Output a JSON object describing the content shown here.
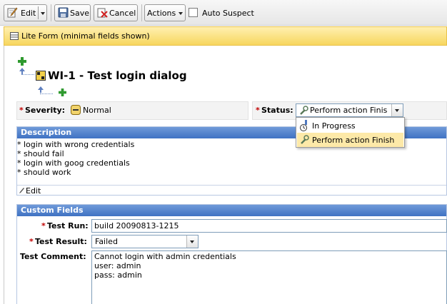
{
  "toolbar": {
    "edit_label": "Edit",
    "save_label": "Save",
    "cancel_label": "Cancel",
    "actions_label": "Actions",
    "auto_suspect_label": "Auto Suspect"
  },
  "banner": {
    "text": "Lite Form (minimal fields shown)"
  },
  "work_item": {
    "title": "WI-1 - Test login dialog"
  },
  "severity": {
    "label": "Severity:",
    "value": "Normal"
  },
  "status": {
    "label": "Status:",
    "value": "Perform action Finis",
    "options": [
      "In Progress",
      "Perform action Finish"
    ]
  },
  "description": {
    "header": "Description",
    "lines": [
      "* login with wrong credentials",
      "* should fail",
      "* login with goog credentials",
      "* should work"
    ],
    "edit_label": "Edit"
  },
  "custom_fields": {
    "header": "Custom Fields",
    "test_run": {
      "label": "Test Run:",
      "value": "build 20090813-1215"
    },
    "test_result": {
      "label": "Test Result:",
      "value": "Failed"
    },
    "test_comment": {
      "label": "Test Comment:",
      "lines": [
        "Cannot login with admin credentials",
        "user: admin",
        "pass: admin"
      ]
    }
  },
  "colors": {
    "section_header": "#4a7bc8",
    "banner": "#f7d65e",
    "required": "#c00000",
    "highlight": "#fde9a8"
  }
}
